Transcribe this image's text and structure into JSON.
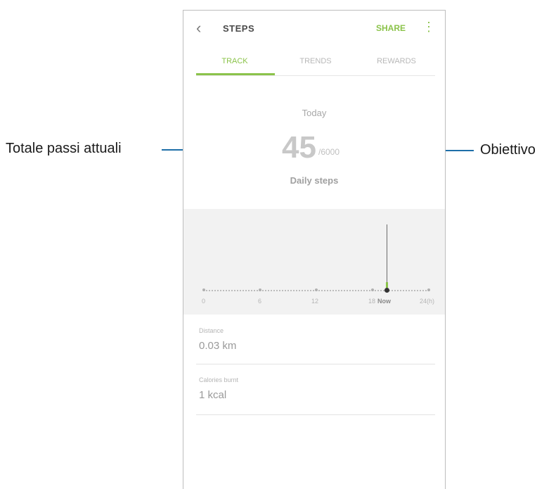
{
  "annotations": {
    "left_callout": "Totale passi attuali",
    "right_callout": "Obiettivo"
  },
  "header": {
    "title": "STEPS",
    "share_label": "SHARE",
    "back_icon": "chevron-left-icon",
    "more_icon": "more-vertical-icon"
  },
  "tabs": [
    {
      "label": "TRACK",
      "active": true
    },
    {
      "label": "TRENDS",
      "active": false
    },
    {
      "label": "REWARDS",
      "active": false
    }
  ],
  "summary": {
    "period_label": "Today",
    "current_steps": "45",
    "goal": "/6000",
    "caption": "Daily steps"
  },
  "chart_data": {
    "type": "bar",
    "x_ticks": [
      "0",
      "6",
      "12",
      "18",
      "24(h)"
    ],
    "now_label": "Now",
    "accent_color": "#8bc34a"
  },
  "stats": [
    {
      "label": "Distance",
      "value": "0.03 km"
    },
    {
      "label": "Calories burnt",
      "value": "1 kcal"
    }
  ],
  "colors": {
    "accent": "#8bc34a",
    "leader_line": "#1e6fa8"
  }
}
